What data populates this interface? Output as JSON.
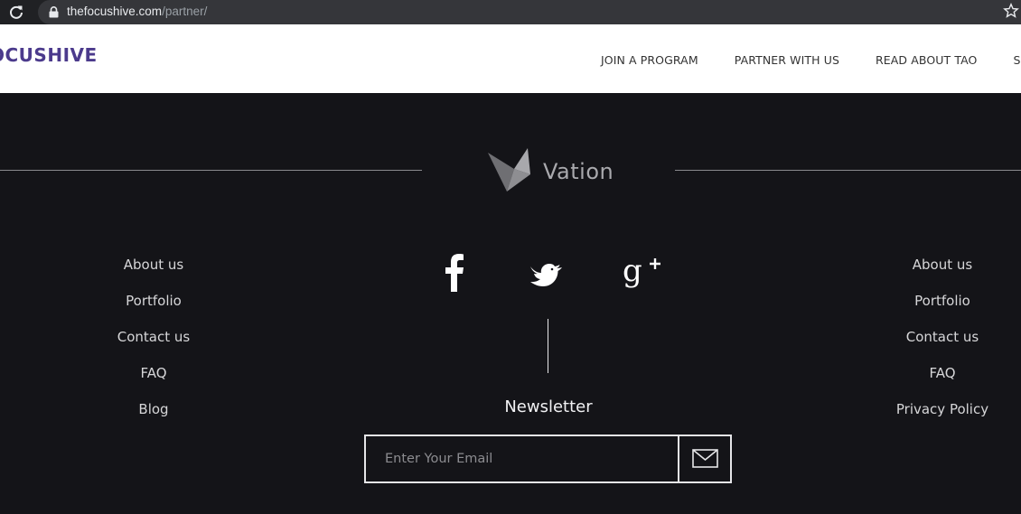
{
  "browser": {
    "url_domain": "thefocushive.com",
    "url_path": "/partner/"
  },
  "header": {
    "logo_text": "OCUSHIVE",
    "nav": [
      {
        "label": "JOIN A PROGRAM"
      },
      {
        "label": "PARTNER WITH US"
      },
      {
        "label": "READ ABOUT TAO"
      },
      {
        "label": "SU"
      }
    ]
  },
  "footer": {
    "brand_name": "Vation",
    "left_links": [
      {
        "label": "About us"
      },
      {
        "label": "Portfolio"
      },
      {
        "label": "Contact us"
      },
      {
        "label": "FAQ"
      },
      {
        "label": "Blog"
      }
    ],
    "right_links": [
      {
        "label": "About us"
      },
      {
        "label": "Portfolio"
      },
      {
        "label": "Contact us"
      },
      {
        "label": "FAQ"
      },
      {
        "label": "Privacy Policy"
      }
    ],
    "social": [
      {
        "icon": "facebook-icon"
      },
      {
        "icon": "twitter-icon"
      },
      {
        "icon": "google-plus-icon"
      }
    ],
    "newsletter": {
      "title": "Newsletter",
      "placeholder": "Enter Your Email",
      "submit_icon": "mail-icon"
    }
  },
  "colors": {
    "footer_bg": "#141418",
    "logo": "#4b3a8c",
    "browser_bg": "#202124"
  }
}
